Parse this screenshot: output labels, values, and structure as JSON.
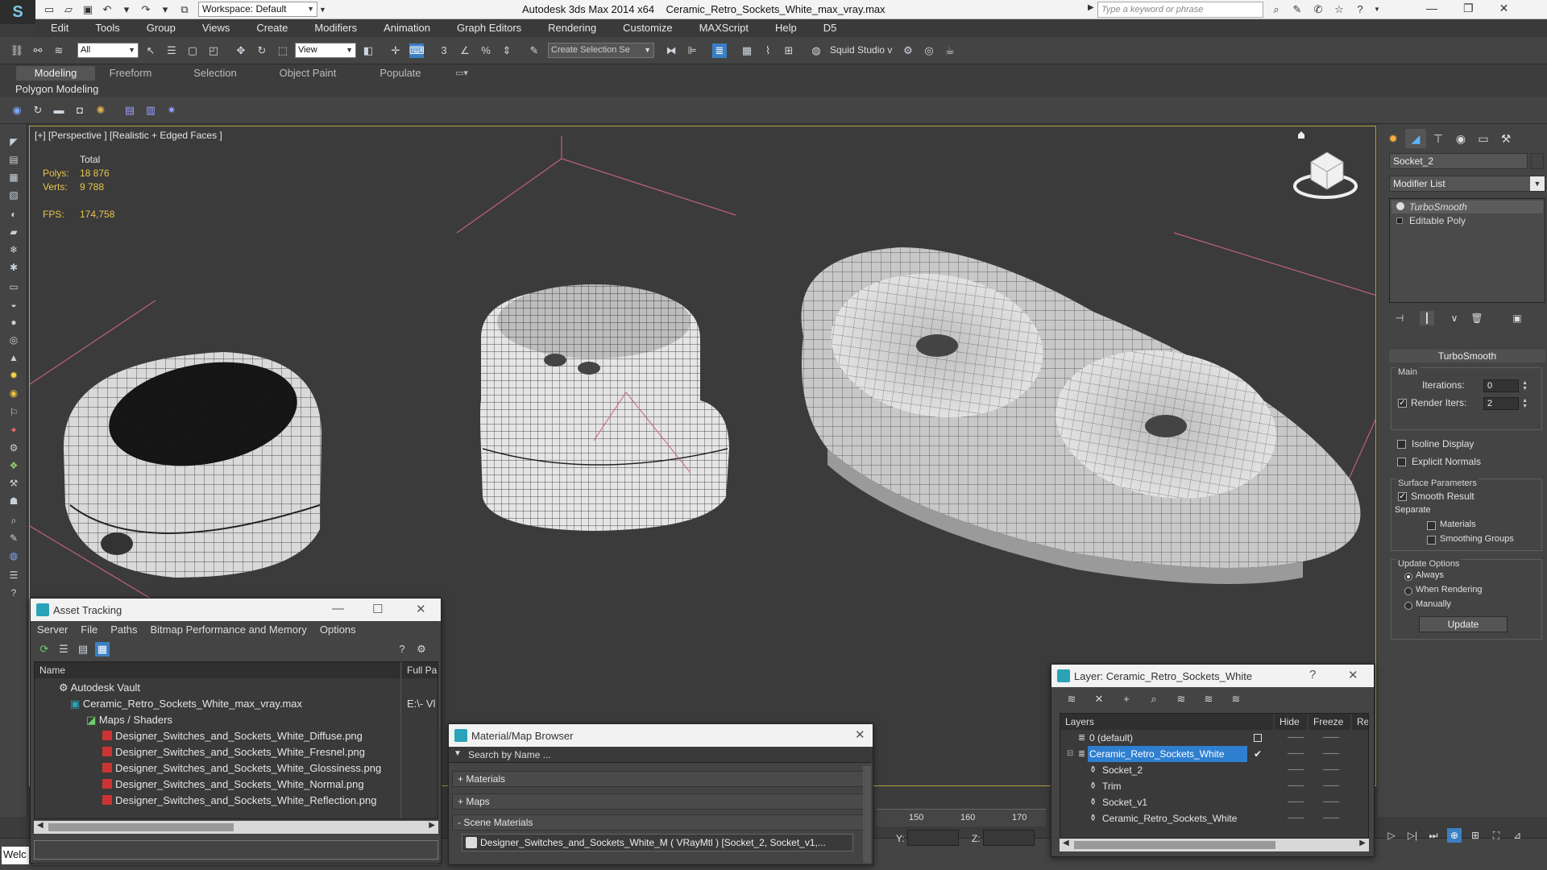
{
  "titlebar": {
    "workspace": "Workspace: Default",
    "app": "Autodesk 3ds Max  2014 x64",
    "file": "Ceramic_Retro_Sockets_White_max_vray.max",
    "search_placeholder": "Type a keyword or phrase"
  },
  "menu": [
    "Edit",
    "Tools",
    "Group",
    "Views",
    "Create",
    "Modifiers",
    "Animation",
    "Graph Editors",
    "Rendering",
    "Customize",
    "MAXScript",
    "Help",
    "D5"
  ],
  "toolbar": {
    "selection_filter": "All",
    "ref_coord": "View",
    "named_selection": "Create Selection Se",
    "squid_label": "Squid Studio v"
  },
  "ribbon": {
    "tabs": [
      "Modeling",
      "Freeform",
      "Selection",
      "Object Paint",
      "Populate"
    ],
    "active_tab": "Modeling",
    "panel": "Polygon Modeling"
  },
  "viewport": {
    "label": "[+] [Perspective ] [Realistic + Edged Faces ]",
    "stats_header": "Total",
    "polys_label": "Polys:",
    "polys_value": "18 876",
    "verts_label": "Verts:",
    "verts_value": "9 788",
    "fps_label": "FPS:",
    "fps_value": "174,758"
  },
  "command_panel": {
    "object_name": "Socket_2",
    "modifier_list": "Modifier List",
    "stack": [
      "TurboSmooth",
      "Editable Poly"
    ],
    "rollout_title": "TurboSmooth",
    "main_group": "Main",
    "iterations_label": "Iterations:",
    "iterations_value": "0",
    "render_iters_label": "Render Iters:",
    "render_iters_value": "2",
    "render_iters_checked": true,
    "isoline_label": "Isoline Display",
    "explicit_normals_label": "Explicit Normals",
    "surface_group": "Surface Parameters",
    "smooth_result_label": "Smooth Result",
    "smooth_result_checked": true,
    "separate_label": "Separate",
    "materials_label": "Materials",
    "smoothing_groups_label": "Smoothing Groups",
    "update_group": "Update Options",
    "always_label": "Always",
    "when_rendering_label": "When Rendering",
    "manually_label": "Manually",
    "update_button": "Update"
  },
  "asset_tracking": {
    "title": "Asset Tracking",
    "menu": [
      "Server",
      "File",
      "Paths",
      "Bitmap Performance and Memory",
      "Options"
    ],
    "col_name": "Name",
    "col_full_path": "Full Pa",
    "rows": [
      {
        "name": "Autodesk Vault",
        "full": ""
      },
      {
        "name": "Ceramic_Retro_Sockets_White_max_vray.max",
        "full": "E:\\- Vl"
      },
      {
        "name": "Maps / Shaders",
        "full": ""
      },
      {
        "name": "Designer_Switches_and_Sockets_White_Diffuse.png",
        "full": ""
      },
      {
        "name": "Designer_Switches_and_Sockets_White_Fresnel.png",
        "full": ""
      },
      {
        "name": "Designer_Switches_and_Sockets_White_Glossiness.png",
        "full": ""
      },
      {
        "name": "Designer_Switches_and_Sockets_White_Normal.png",
        "full": ""
      },
      {
        "name": "Designer_Switches_and_Sockets_White_Reflection.png",
        "full": ""
      }
    ]
  },
  "material_browser": {
    "title": "Material/Map Browser",
    "search_placeholder": "Search by Name ...",
    "groups": [
      "+ Materials",
      "+ Maps",
      "- Scene Materials"
    ],
    "entry": "Designer_Switches_and_Sockets_White_M ( VRayMtl ) [Socket_2, Socket_v1,..."
  },
  "layer_window": {
    "title": "Layer: Ceramic_Retro_Sockets_White",
    "col_layers": "Layers",
    "col_hide": "Hide",
    "col_freeze": "Freeze",
    "col_render": "Re",
    "rows": [
      {
        "name": "0 (default)"
      },
      {
        "name": "Ceramic_Retro_Sockets_White"
      },
      {
        "name": "Socket_2"
      },
      {
        "name": "Trim"
      },
      {
        "name": "Socket_v1"
      },
      {
        "name": "Ceramic_Retro_Sockets_White"
      }
    ]
  },
  "timeline": {
    "ticks": [
      "150",
      "160",
      "170"
    ]
  },
  "status": {
    "maxscript": "Welc",
    "y_label": "Y:",
    "z_label": "Z:"
  }
}
